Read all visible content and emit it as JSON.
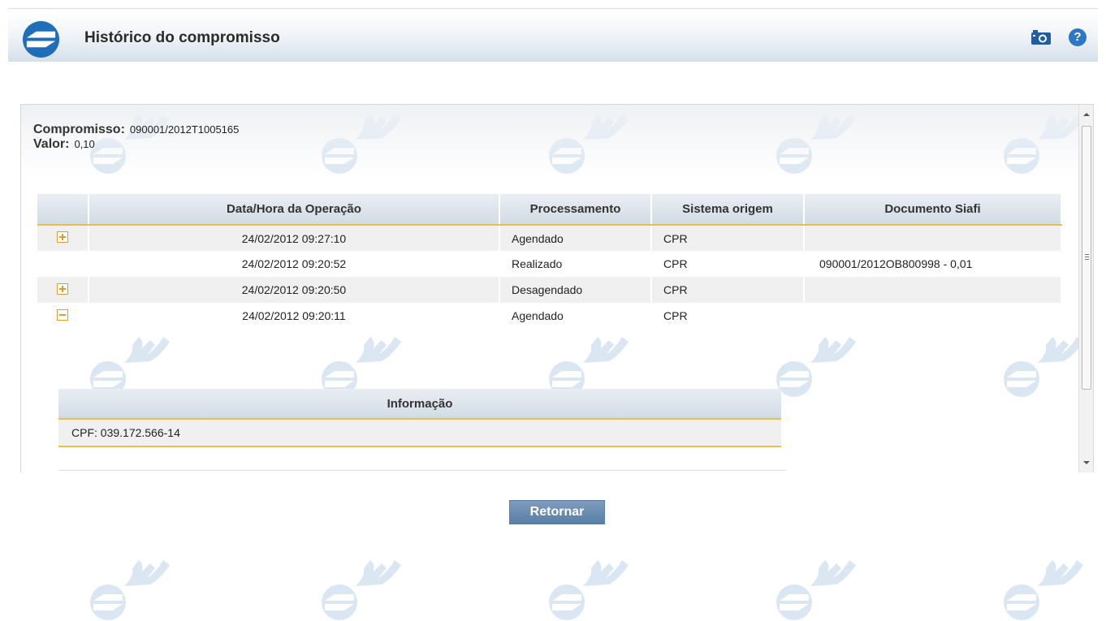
{
  "header": {
    "title": "Histórico do compromisso",
    "camera_icon": "camera-icon",
    "help_icon": "help-icon",
    "help_glyph": "?"
  },
  "summary": {
    "compromisso_label": "Compromisso:",
    "compromisso_value": "090001/2012T1005165",
    "valor_label": "Valor:",
    "valor_value": "0,10"
  },
  "table": {
    "columns": [
      "",
      "Data/Hora da Operação",
      "Processamento",
      "Sistema origem",
      "Documento Siafi"
    ],
    "rows": [
      {
        "toggle": "plus",
        "datetime": "24/02/2012 09:27:10",
        "processamento": "Agendado",
        "sistema": "CPR",
        "documento": ""
      },
      {
        "toggle": "none",
        "datetime": "24/02/2012 09:20:52",
        "processamento": "Realizado",
        "sistema": "CPR",
        "documento": "090001/2012OB800998 - 0,01"
      },
      {
        "toggle": "plus",
        "datetime": "24/02/2012 09:20:50",
        "processamento": "Desagendado",
        "sistema": "CPR",
        "documento": ""
      },
      {
        "toggle": "minus",
        "datetime": "24/02/2012 09:20:11",
        "processamento": "Agendado",
        "sistema": "CPR",
        "documento": ""
      }
    ]
  },
  "detail": {
    "header": "Informação",
    "row": "CPF: 039.172.566-14"
  },
  "actions": {
    "retornar_label": "Retornar"
  },
  "colors": {
    "accent_gold": "#e8c247",
    "button_blue": "#5a7ea6",
    "logo_blue": "#1f6fb8"
  }
}
